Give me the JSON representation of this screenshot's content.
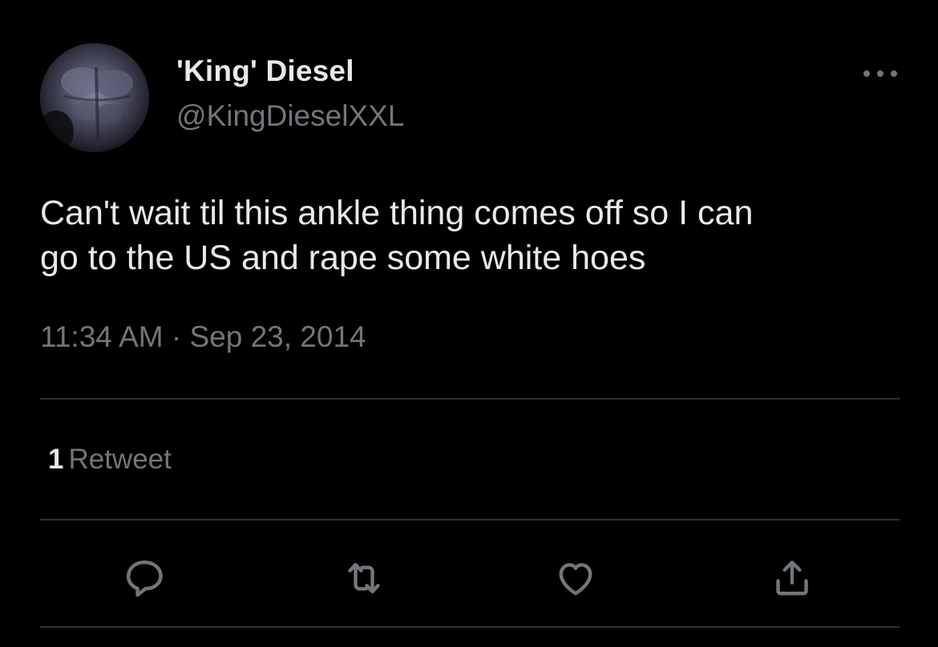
{
  "author": {
    "display_name": "'King' Diesel",
    "handle": "@KingDieselXXL",
    "avatar_icon": "user-avatar"
  },
  "tweet": {
    "text": "Can't wait til this ankle thing comes off so I can\ngo to the US and rape some white hoes",
    "timestamp": "11:34 AM · Sep 23, 2014"
  },
  "stats": {
    "retweet_count": "1",
    "retweet_label": "Retweet"
  },
  "actions": [
    {
      "name": "reply",
      "icon": "reply-icon"
    },
    {
      "name": "retweet",
      "icon": "retweet-icon"
    },
    {
      "name": "like",
      "icon": "heart-icon"
    },
    {
      "name": "share",
      "icon": "share-icon"
    }
  ],
  "colors": {
    "background": "#000000",
    "primary_text": "#e7e9ea",
    "secondary_text": "#71767b",
    "divider": "#2f3336"
  }
}
